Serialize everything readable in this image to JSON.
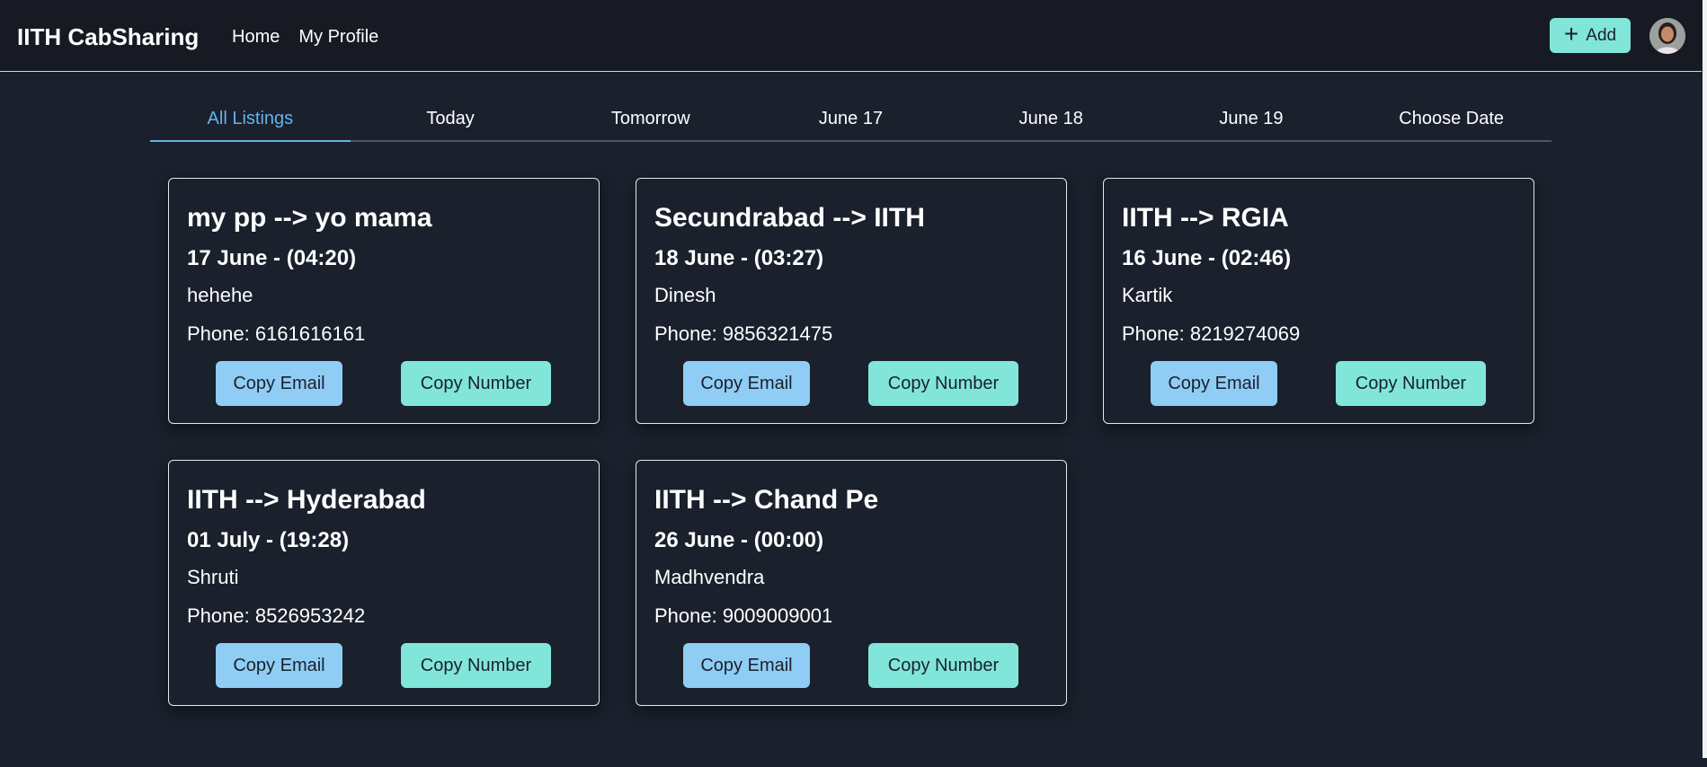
{
  "app": {
    "title": "IITH CabSharing"
  },
  "nav": {
    "links": [
      "Home",
      "My Profile"
    ],
    "add_label": "Add"
  },
  "tabs": [
    {
      "label": "All Listings",
      "active": true
    },
    {
      "label": "Today",
      "active": false
    },
    {
      "label": "Tomorrow",
      "active": false
    },
    {
      "label": "June 17",
      "active": false
    },
    {
      "label": "June 18",
      "active": false
    },
    {
      "label": "June 19",
      "active": false
    },
    {
      "label": "Choose Date",
      "active": false
    }
  ],
  "listings": [
    {
      "route": "my pp --> yo mama",
      "datetime": "17 June - (04:20)",
      "name": "hehehe",
      "phone": "Phone: 6161616161"
    },
    {
      "route": "Secundrabad --> IITH",
      "datetime": "18 June - (03:27)",
      "name": "Dinesh",
      "phone": "Phone: 9856321475"
    },
    {
      "route": "IITH --> RGIA",
      "datetime": "16 June - (02:46)",
      "name": "Kartik",
      "phone": "Phone: 8219274069"
    },
    {
      "route": "IITH --> Hyderabad",
      "datetime": "01 July - (19:28)",
      "name": "Shruti",
      "phone": "Phone: 8526953242"
    },
    {
      "route": "IITH --> Chand Pe",
      "datetime": "26 June - (00:00)",
      "name": "Madhvendra",
      "phone": "Phone: 9009009001"
    }
  ],
  "card_buttons": {
    "copy_email": "Copy Email",
    "copy_number": "Copy Number"
  },
  "colors": {
    "background": "#1a202c",
    "accent_blue": "#90cdf4",
    "accent_teal": "#81e6d9",
    "active_tab": "#63b3ed"
  }
}
